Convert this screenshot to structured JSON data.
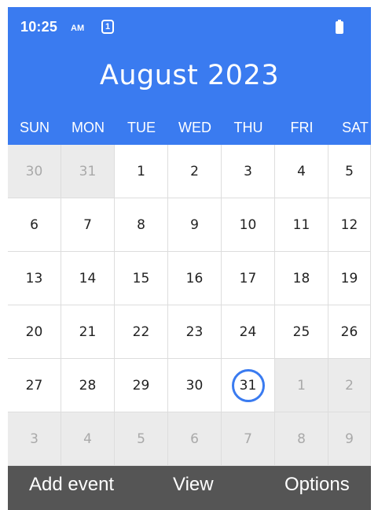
{
  "status": {
    "time": "10:25",
    "ampm": "AM",
    "notification_count": "1",
    "battery_icon": "battery-icon"
  },
  "calendar": {
    "month_title": "August 2023",
    "days_of_week": [
      "SUN",
      "MON",
      "TUE",
      "WED",
      "THU",
      "FRI",
      "SAT"
    ],
    "weeks": [
      [
        {
          "d": "30",
          "out": true
        },
        {
          "d": "31",
          "out": true
        },
        {
          "d": "1"
        },
        {
          "d": "2"
        },
        {
          "d": "3"
        },
        {
          "d": "4"
        },
        {
          "d": "5"
        }
      ],
      [
        {
          "d": "6"
        },
        {
          "d": "7"
        },
        {
          "d": "8"
        },
        {
          "d": "9"
        },
        {
          "d": "10"
        },
        {
          "d": "11"
        },
        {
          "d": "12"
        }
      ],
      [
        {
          "d": "13"
        },
        {
          "d": "14"
        },
        {
          "d": "15"
        },
        {
          "d": "16"
        },
        {
          "d": "17"
        },
        {
          "d": "18"
        },
        {
          "d": "19"
        }
      ],
      [
        {
          "d": "20"
        },
        {
          "d": "21"
        },
        {
          "d": "22"
        },
        {
          "d": "23"
        },
        {
          "d": "24"
        },
        {
          "d": "25"
        },
        {
          "d": "26"
        }
      ],
      [
        {
          "d": "27"
        },
        {
          "d": "28"
        },
        {
          "d": "29"
        },
        {
          "d": "30"
        },
        {
          "d": "31",
          "today": true
        },
        {
          "d": "1",
          "out": true
        },
        {
          "d": "2",
          "out": true
        }
      ],
      [
        {
          "d": "3",
          "out": true
        },
        {
          "d": "4",
          "out": true
        },
        {
          "d": "5",
          "out": true
        },
        {
          "d": "6",
          "out": true
        },
        {
          "d": "7",
          "out": true
        },
        {
          "d": "8",
          "out": true
        },
        {
          "d": "9",
          "out": true
        }
      ]
    ],
    "accent_color": "#3a7bf0"
  },
  "softkeys": {
    "left": "Add event",
    "center": "View",
    "right": "Options"
  }
}
